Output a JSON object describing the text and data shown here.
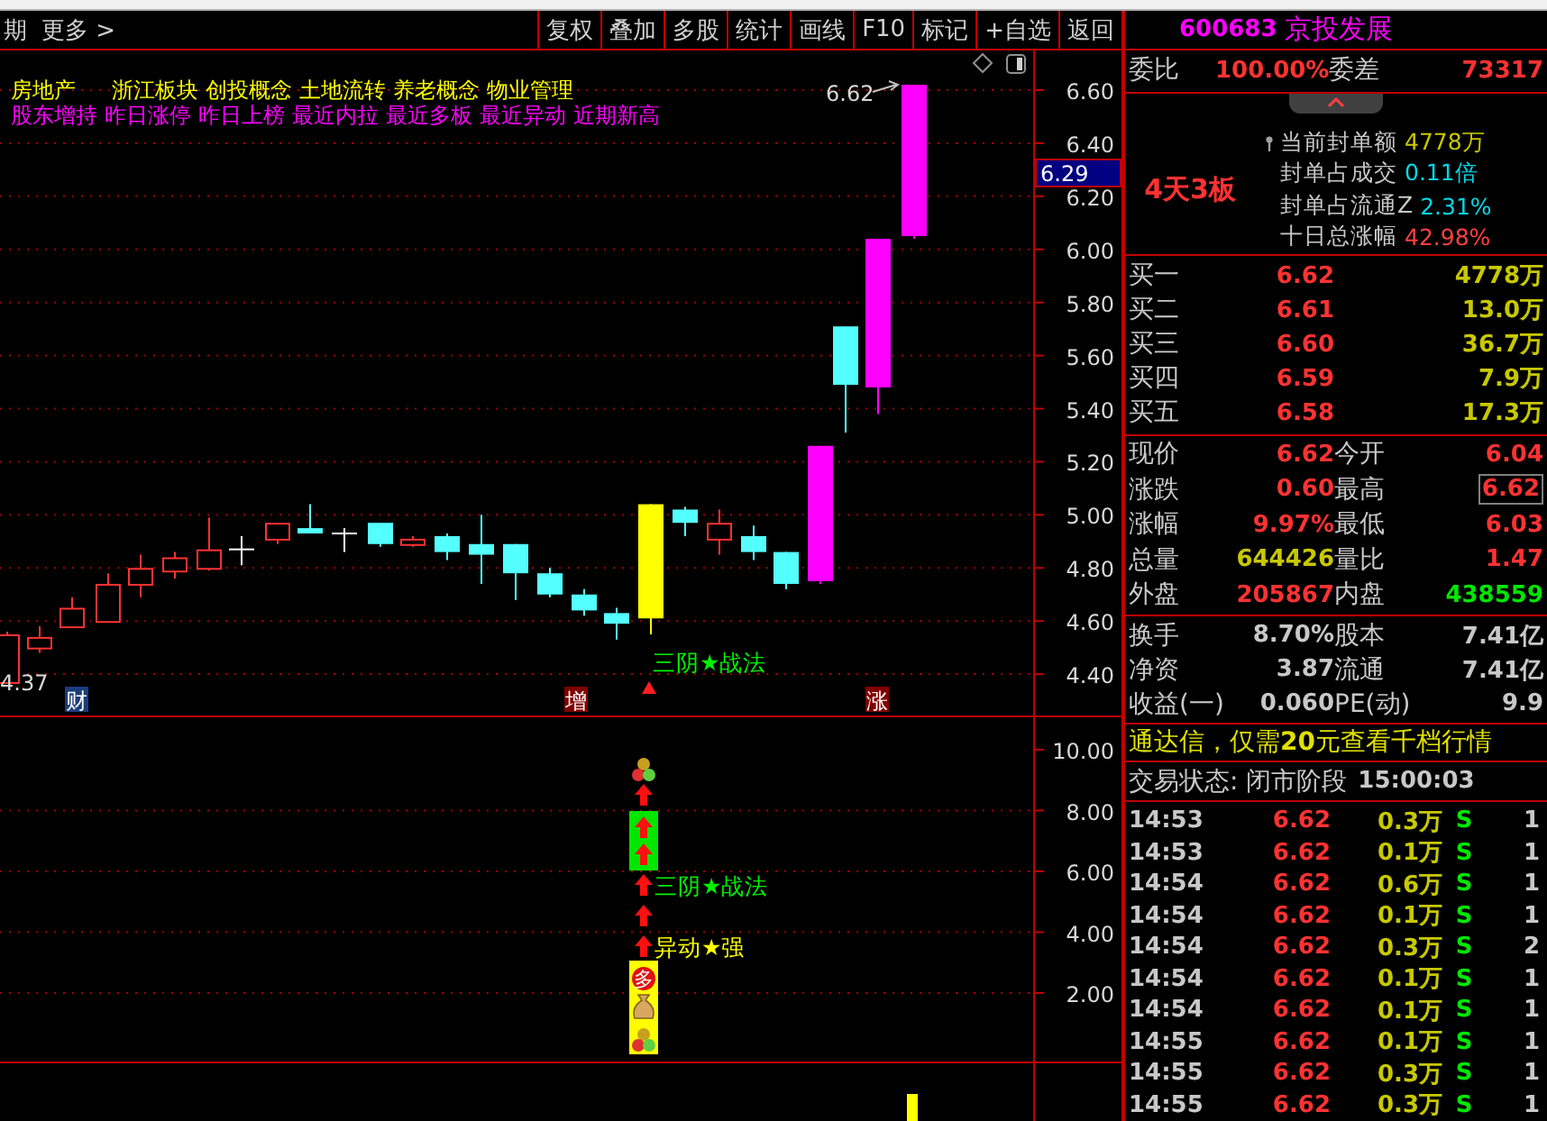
{
  "toolbar": {
    "period_label": "期",
    "more_menu": "更多 >",
    "buttons": [
      "复权",
      "叠加",
      "多股",
      "统计",
      "画线",
      "F10",
      "标记",
      "+自选",
      "返回"
    ]
  },
  "chart": {
    "concepts": [
      "房地产",
      "浙江板块",
      "创投概念",
      "土地流转",
      "养老概念",
      "物业管理"
    ],
    "signals": [
      "股东增持",
      "昨日涨停",
      "昨日上榜",
      "最近内拉",
      "最近多板",
      "最近异动",
      "近期新高"
    ],
    "price_axis": [
      "6.60",
      "6.40",
      "6.20",
      "6.00",
      "5.80",
      "5.60",
      "5.40",
      "5.20",
      "5.00",
      "4.80",
      "4.60",
      "4.40"
    ],
    "last_price_tag": "6.29",
    "high_label": "6.62",
    "low_label": "4.37",
    "pattern_label": "三阴★战法",
    "event_badges": [
      {
        "text": "财",
        "color": "#1c3c7c"
      },
      {
        "text": "增",
        "color": "#800000"
      },
      {
        "text": "涨",
        "color": "#800000"
      }
    ]
  },
  "indicator": {
    "axis": [
      "10.00",
      "8.00",
      "6.00",
      "4.00",
      "2.00"
    ],
    "pattern_label": "三阴★战法",
    "anomaly_label": "异动★强",
    "badge": "多"
  },
  "stock": {
    "code": "600683",
    "name": "京投发展"
  },
  "order_ratio": {
    "label": "委比",
    "value": "100.00%",
    "diff_label": "委差",
    "diff_value": "73317"
  },
  "seal_info": {
    "board_streak": "4天3板",
    "lines": [
      {
        "label": "当前封单额",
        "value": "4778万",
        "color": "#c8c800"
      },
      {
        "label": "封单占成交",
        "value": "0.11倍",
        "color": "#00d8e8"
      },
      {
        "label": "封单占流通Z",
        "value": "2.31%",
        "color": "#00d8e8"
      },
      {
        "label": "十日总涨幅",
        "value": "42.98%",
        "color": "#ff4040"
      }
    ]
  },
  "bids": [
    {
      "label": "买一",
      "price": "6.62",
      "volume": "4778万"
    },
    {
      "label": "买二",
      "price": "6.61",
      "volume": "13.0万"
    },
    {
      "label": "买三",
      "price": "6.60",
      "volume": "36.7万"
    },
    {
      "label": "买四",
      "price": "6.59",
      "volume": "7.9万"
    },
    {
      "label": "买五",
      "price": "6.58",
      "volume": "17.3万"
    }
  ],
  "quote": [
    {
      "label": "现价",
      "value": "6.62",
      "color": "#ff3232",
      "boxed": false
    },
    {
      "label": "今开",
      "value": "6.04",
      "color": "#ff3232",
      "boxed": false
    },
    {
      "label": "涨跌",
      "value": "0.60",
      "color": "#ff3232",
      "boxed": false
    },
    {
      "label": "最高",
      "value": "6.62",
      "color": "#ff3232",
      "boxed": true
    },
    {
      "label": "涨幅",
      "value": "9.97%",
      "color": "#ff3232",
      "boxed": false
    },
    {
      "label": "最低",
      "value": "6.03",
      "color": "#ff3232",
      "boxed": false
    },
    {
      "label": "总量",
      "value": "644426",
      "color": "#c8c800",
      "boxed": false
    },
    {
      "label": "量比",
      "value": "1.47",
      "color": "#ff3232",
      "boxed": false
    },
    {
      "label": "外盘",
      "value": "205867",
      "color": "#ff3232",
      "boxed": false
    },
    {
      "label": "内盘",
      "value": "438559",
      "color": "#00e600",
      "boxed": false
    }
  ],
  "stats": [
    {
      "label": "换手",
      "value": "8.70%"
    },
    {
      "label": "股本",
      "value": "7.41亿"
    },
    {
      "label": "净资",
      "value": "3.87"
    },
    {
      "label": "流通",
      "value": "7.41亿"
    },
    {
      "label": "收益(一)",
      "value": "0.060"
    },
    {
      "label": "PE(动)",
      "value": "9.9"
    }
  ],
  "promo": "通达信，仅需**20**元查看千档行情",
  "trade_status": {
    "label": "交易状态: 闭市阶段",
    "time": "15:00:03"
  },
  "trades": [
    {
      "time": "14:53",
      "price": "6.62",
      "volume": "0.3万",
      "side": "S",
      "count": "1"
    },
    {
      "time": "14:53",
      "price": "6.62",
      "volume": "0.1万",
      "side": "S",
      "count": "1"
    },
    {
      "time": "14:54",
      "price": "6.62",
      "volume": "0.6万",
      "side": "S",
      "count": "1"
    },
    {
      "time": "14:54",
      "price": "6.62",
      "volume": "0.1万",
      "side": "S",
      "count": "1"
    },
    {
      "time": "14:54",
      "price": "6.62",
      "volume": "0.3万",
      "side": "S",
      "count": "2"
    },
    {
      "time": "14:54",
      "price": "6.62",
      "volume": "0.1万",
      "side": "S",
      "count": "1"
    },
    {
      "time": "14:54",
      "price": "6.62",
      "volume": "0.1万",
      "side": "S",
      "count": "1"
    },
    {
      "time": "14:55",
      "price": "6.62",
      "volume": "0.1万",
      "side": "S",
      "count": "1"
    },
    {
      "time": "14:55",
      "price": "6.62",
      "volume": "0.3万",
      "side": "S",
      "count": "1"
    },
    {
      "time": "14:55",
      "price": "6.62",
      "volume": "0.3万",
      "side": "S",
      "count": "1"
    }
  ]
}
